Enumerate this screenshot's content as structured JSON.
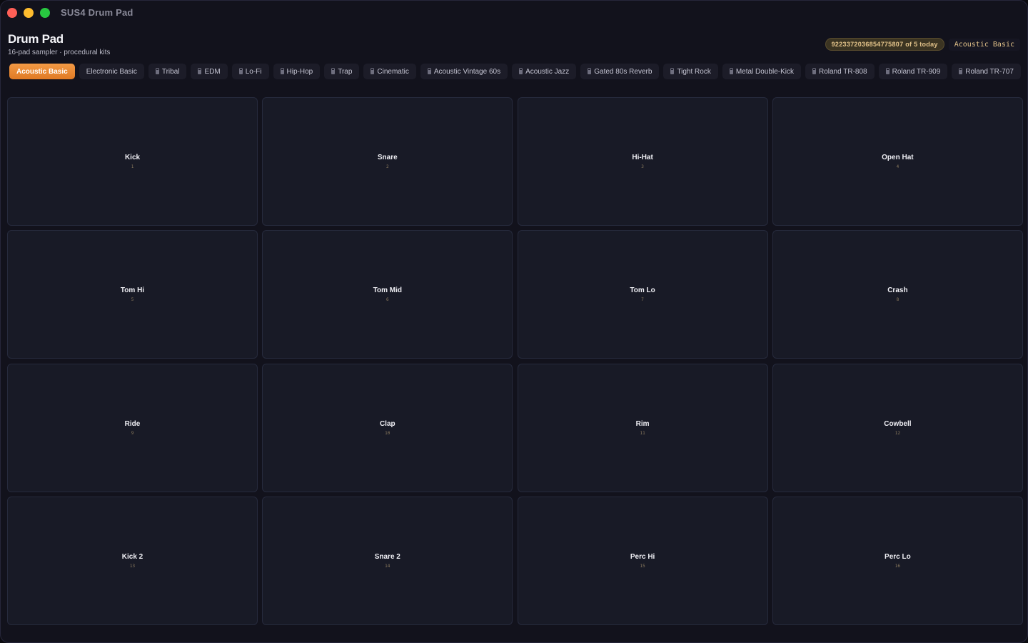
{
  "window": {
    "title": "SUS4 Drum Pad"
  },
  "header": {
    "title": "Drum Pad",
    "subtitle": "16-pad sampler · procedural kits",
    "usage_badge": "9223372036854775807 of 5 today",
    "current_kit": "Acoustic Basic"
  },
  "kits": [
    {
      "label": "Acoustic Basic",
      "active": true,
      "locked": false
    },
    {
      "label": "Electronic Basic",
      "active": false,
      "locked": false
    },
    {
      "label": "Tribal",
      "active": false,
      "locked": true
    },
    {
      "label": "EDM",
      "active": false,
      "locked": true
    },
    {
      "label": "Lo-Fi",
      "active": false,
      "locked": true
    },
    {
      "label": "Hip-Hop",
      "active": false,
      "locked": true
    },
    {
      "label": "Trap",
      "active": false,
      "locked": true
    },
    {
      "label": "Cinematic",
      "active": false,
      "locked": true
    },
    {
      "label": "Acoustic Vintage 60s",
      "active": false,
      "locked": true
    },
    {
      "label": "Acoustic Jazz",
      "active": false,
      "locked": true
    },
    {
      "label": "Gated 80s Reverb",
      "active": false,
      "locked": true
    },
    {
      "label": "Tight Rock",
      "active": false,
      "locked": true
    },
    {
      "label": "Metal Double-Kick",
      "active": false,
      "locked": true
    },
    {
      "label": "Roland TR-808",
      "active": false,
      "locked": true
    },
    {
      "label": "Roland TR-909",
      "active": false,
      "locked": true
    },
    {
      "label": "Roland TR-707",
      "active": false,
      "locked": true
    }
  ],
  "pads": [
    {
      "name": "Kick",
      "number": "1"
    },
    {
      "name": "Snare",
      "number": "2"
    },
    {
      "name": "Hi-Hat",
      "number": "3"
    },
    {
      "name": "Open Hat",
      "number": "4"
    },
    {
      "name": "Tom Hi",
      "number": "5"
    },
    {
      "name": "Tom Mid",
      "number": "6"
    },
    {
      "name": "Tom Lo",
      "number": "7"
    },
    {
      "name": "Crash",
      "number": "8"
    },
    {
      "name": "Ride",
      "number": "9"
    },
    {
      "name": "Clap",
      "number": "10"
    },
    {
      "name": "Rim",
      "number": "11"
    },
    {
      "name": "Cowbell",
      "number": "12"
    },
    {
      "name": "Kick 2",
      "number": "13"
    },
    {
      "name": "Snare 2",
      "number": "14"
    },
    {
      "name": "Perc Hi",
      "number": "15"
    },
    {
      "name": "Perc Lo",
      "number": "16"
    }
  ],
  "colors": {
    "accent": "#f29a45",
    "pad_background": "#181a26",
    "window_background": "#12121c"
  }
}
